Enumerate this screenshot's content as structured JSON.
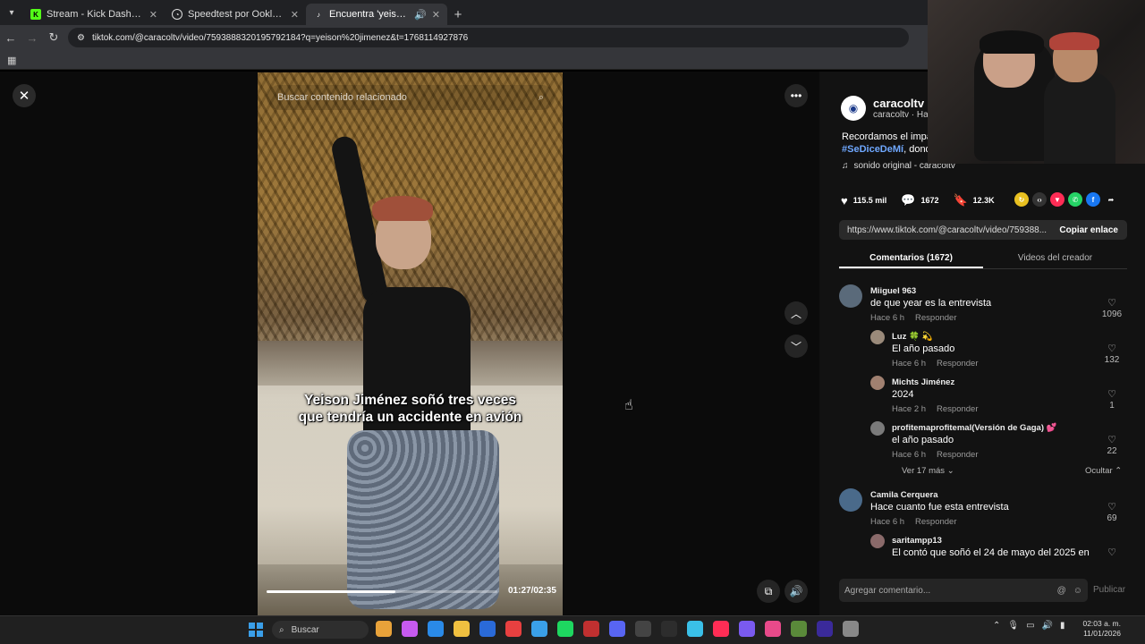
{
  "browser": {
    "tabs": [
      {
        "title": "Stream - Kick Dashboard",
        "favicon": "kick-icon",
        "color": "#53fc18",
        "active": false
      },
      {
        "title": "Speedtest por Ookla - La prueba",
        "favicon": "speedtest-icon",
        "color": "#ffffff",
        "active": false
      },
      {
        "title": "Encuentra 'yeison jimenez'",
        "favicon": "tiktok-icon",
        "color": "#ffffff",
        "active": true
      }
    ],
    "url": "tiktok.com/@caracoltv/video/7593888320195792184?q=yeison%20jimenez&t=1768114927876"
  },
  "video": {
    "search_placeholder": "Buscar contenido relacionado",
    "caption_line1": "Yeison Jiménez soñó tres veces",
    "caption_line2": "que tendría un accidente en avión",
    "time": "01:27/02:35",
    "progress_fraction": 0.56
  },
  "post": {
    "author": "caracoltv",
    "author_sub": "caracoltv · Ha",
    "desc_line1": "Recordamos el impa",
    "hashtag": "#SeDiceDeMí",
    "desc_line2_rest": ", dond",
    "sound": "sonido original - caracoltv",
    "likes": "115.5 mil",
    "comments": "1672",
    "saves": "12.3K",
    "link": "https://www.tiktok.com/@caracoltv/video/759388...",
    "copy_label": "Copiar enlace",
    "tab_comments": "Comentarios (1672)",
    "tab_creator": "Videos del creador"
  },
  "comments": [
    {
      "user": "Miiguel 963",
      "text": "de que year es la entrevista",
      "time": "Hace 6 h",
      "reply": "Responder",
      "likes": "1096",
      "is_reply": false,
      "avatar_color": "#5a6a7a"
    },
    {
      "user": "Luz 🍀 💫",
      "text": "El año pasado",
      "time": "Hace 6 h",
      "reply": "Responder",
      "likes": "132",
      "is_reply": true,
      "avatar_color": "#9a8a7a"
    },
    {
      "user": "Michts Jiménez",
      "text": "2024",
      "time": "Hace 2 h",
      "reply": "Responder",
      "likes": "1",
      "is_reply": true,
      "avatar_color": "#a08070"
    },
    {
      "user": "profitemaprofitemal(Versión de Gaga) 💕",
      "text": "el año pasado",
      "time": "Hace 6 h",
      "reply": "Responder",
      "likes": "22",
      "is_reply": true,
      "avatar_color": "#7a7a7a"
    },
    {
      "user": "Camila Cerquera",
      "text": "Hace cuanto fue esta entrevista",
      "time": "Hace 6 h",
      "reply": "Responder",
      "likes": "69",
      "is_reply": false,
      "avatar_color": "#4a6a8a"
    },
    {
      "user": "saritampp13",
      "text": "El contó que soñó el 24 de mayo del 2025 en",
      "time": "",
      "reply": "",
      "likes": "",
      "is_reply": true,
      "avatar_color": "#8a6a6a"
    }
  ],
  "more_replies": "Ver 17 más",
  "hide_label": "Ocultar",
  "add_comment_placeholder": "Agregar comentario...",
  "publish_label": "Publicar",
  "taskbar": {
    "search": "Buscar",
    "time": "02:03 a. m.",
    "date": "11/01/2026",
    "icon_colors": [
      "#e8a23a",
      "#c75af0",
      "#2a8ae8",
      "#f0c040",
      "#2a6ad8",
      "#e84040",
      "#3aa0e8",
      "#1ed760",
      "#c03030",
      "#5865f2",
      "#444444",
      "#2d2d2d",
      "#3ac0e8",
      "#ff2d55",
      "#7a5af0",
      "#e84a8a",
      "#5a8a3a",
      "#3a2a9a",
      "#888888"
    ]
  }
}
